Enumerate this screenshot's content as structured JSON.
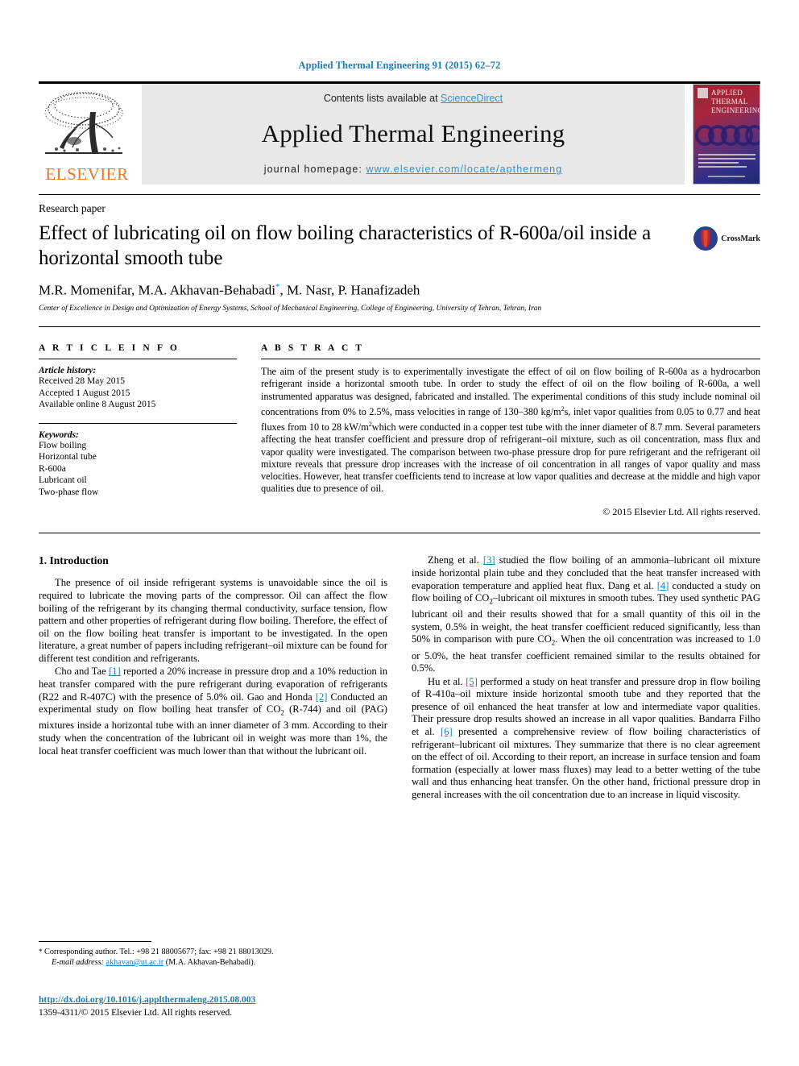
{
  "running_head": "Applied Thermal Engineering 91 (2015) 62–72",
  "masthead": {
    "publisher_logo_text": "ELSEVIER",
    "contents_prefix": "Contents lists available at ",
    "contents_link": "ScienceDirect",
    "journal_name": "Applied Thermal Engineering",
    "homepage_prefix": "journal homepage: ",
    "homepage_url": "www.elsevier.com/locate/apthermeng",
    "cover_title_line1": "APPLIED",
    "cover_title_line2": "THERMAL",
    "cover_title_line3": "ENGINEERING",
    "link_color": "#3b8fc4"
  },
  "article": {
    "type": "Research paper",
    "title": "Effect of lubricating oil on flow boiling characteristics of R-600a/oil inside a horizontal smooth tube",
    "crossmark_label": "CrossMark",
    "authors": "M.R. Momenifar, M.A. Akhavan-Behabadi",
    "authors_after_star": ", M. Nasr, P. Hanafizadeh",
    "corresponding_star": "*",
    "affiliation": "Center of Excellence in Design and Optimization of Energy Systems, School of Mechanical Engineering, College of Engineering, University of Tehran, Tehran, Iran"
  },
  "article_info": {
    "heading": "A R T I C L E  I N F O",
    "history_label": "Article history:",
    "history": [
      "Received 28 May 2015",
      "Accepted 1 August 2015",
      "Available online 8 August 2015"
    ],
    "keywords_label": "Keywords:",
    "keywords": [
      "Flow boiling",
      "Horizontal tube",
      "R-600a",
      "Lubricant oil",
      "Two-phase flow"
    ]
  },
  "abstract": {
    "heading": "A B S T R A C T",
    "part1": "The aim of the present study is to experimentally investigate the effect of oil on flow boiling of R-600a as a hydrocarbon refrigerant inside a horizontal smooth tube. In order to study the effect of oil on the flow boiling of R-600a, a well instrumented apparatus was designed, fabricated and installed. The experimental conditions of this study include nominal oil concentrations from 0% to 2.5%, mass velocities in range of 130–380 kg/m",
    "sup1": "2",
    "part2": "s, inlet vapor qualities from 0.05 to 0.77 and heat fluxes from 10 to 28 kW/m",
    "sup2": "2",
    "part3": "which were conducted in a copper test tube with the inner diameter of 8.7 mm. Several parameters affecting the heat transfer coefficient and pressure drop of refrigerant–oil mixture, such as oil concentration, mass flux and vapor quality were investigated. The comparison between two-phase pressure drop for pure refrigerant and the refrigerant oil mixture reveals that pressure drop increases with the increase of oil concentration in all ranges of vapor quality and mass velocities. However, heat transfer coefficients tend to increase at low vapor qualities and decrease at the middle and high vapor qualities due to presence of oil.",
    "copyright": "© 2015 Elsevier Ltd. All rights reserved."
  },
  "body": {
    "section1_heading": "1. Introduction",
    "left": {
      "p1": "The presence of oil inside refrigerant systems is unavoidable since the oil is required to lubricate the moving parts of the compressor. Oil can affect the flow boiling of the refrigerant by its changing thermal conductivity, surface tension, flow pattern and other properties of refrigerant during flow boiling. Therefore, the effect of oil on the flow boiling heat transfer is important to be investigated. In the open literature, a great number of papers including refrigerant–oil mixture can be found for different test condition and refrigerants.",
      "p2_a": "Cho and Tae ",
      "p2_ref1": "[1]",
      "p2_b": " reported a 20% increase in pressure drop and a 10% reduction in heat transfer compared with the pure refrigerant during evaporation of refrigerants (R22 and R-407C) with the presence of 5.0% oil. Gao and Honda ",
      "p2_ref2": "[2]",
      "p2_c": " Conducted an experimental study on flow boiling heat transfer of CO",
      "p2_sub": "2",
      "p2_d": " (R-744) and oil (PAG) mixtures inside a horizontal tube with an inner diameter of 3 mm. According to their study when the concentration of the lubricant oil in weight was more than 1%, the local heat transfer coefficient was much lower than that without the lubricant oil."
    },
    "right": {
      "p3_a": "Zheng et al. ",
      "p3_ref1": "[3]",
      "p3_b": " studied the flow boiling of an ammonia–lubricant oil mixture inside horizontal plain tube and they concluded that the heat transfer increased with evaporation temperature and applied heat flux. Dang et al. ",
      "p3_ref2": "[4]",
      "p3_c": " conducted a study on flow boiling of CO",
      "p3_sub1": "2",
      "p3_d": "–lubricant oil mixtures in smooth tubes. They used synthetic PAG lubricant oil and their results showed that for a small quantity of this oil in the system, 0.5% in weight, the heat transfer coefficient reduced significantly, less than 50% in comparison with pure CO",
      "p3_sub2": "2",
      "p3_e": ". When the oil concentration was increased to 1.0 or 5.0%, the heat transfer coefficient remained similar to the results obtained for 0.5%.",
      "p4_a": "Hu et al. ",
      "p4_ref1": "[5]",
      "p4_b": " performed a study on heat transfer and pressure drop in flow boiling of R-410a–oil mixture inside horizontal smooth tube and they reported that the presence of oil enhanced the heat transfer at low and intermediate vapor qualities. Their pressure drop results showed an increase in all vapor qualities. Bandarra Filho et al. ",
      "p4_ref2": "[6]",
      "p4_c": " presented a comprehensive review of flow boiling characteristics of refrigerant–lubricant oil mixtures. They summarize that there is no clear agreement on the effect of oil. According to their report, an increase in surface tension and foam formation (especially at lower mass fluxes) may lead to a better wetting of the tube wall and thus enhancing heat transfer. On the other hand, frictional pressure drop in general increases with the oil concentration due to an increase in liquid viscosity."
    }
  },
  "footnote": {
    "star": "*",
    "corresponding": " Corresponding author. Tel.: +98 21 88005677; fax: +98 21 88013029.",
    "email_label": "E-mail address:",
    "email": "akhavan@ut.ac.ir",
    "email_owner": " (M.A. Akhavan-Behabadi).",
    "doi": "http://dx.doi.org/10.1016/j.applthermaleng.2015.08.003",
    "issn": "1359-4311/© 2015 Elsevier Ltd. All rights reserved."
  }
}
